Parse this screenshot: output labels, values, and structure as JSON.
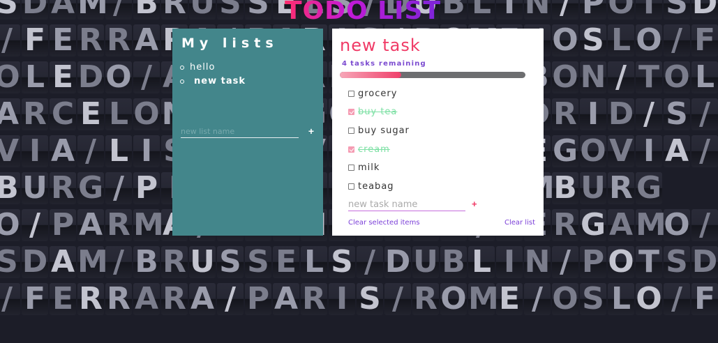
{
  "app": {
    "title": "TODO LIST"
  },
  "background": {
    "rows": [
      "SDAM/BRUSSELS/DUBLIN/POTSDAM/",
      "/FERRARA/PARIS/ROME/OSLO/FE",
      "OLEDO/AMSTERDAM/LISBON/TOLEDO",
      "ARCELONA/SEGOVIA/MADRID/S/BARCE",
      "VIA/LISBON/VIENNA/SEGOVIA/SEGOVIA",
      "BURG/PISA/MILANO/HAMBURG",
      "O/PARMA/FRANKFURT/BERGAMO/PA",
      "SDAM/BRUSSELS/DUBLIN/POTSDAM/",
      "/FERRARA/PARIS/ROME/OSLO/FE"
    ]
  },
  "lists_panel": {
    "title": "My lists",
    "items": [
      {
        "label": "hello",
        "active": false
      },
      {
        "label": "new task",
        "active": true
      }
    ],
    "new_list_placeholder": "new list name",
    "add_label": "+"
  },
  "task_panel": {
    "title": "new task",
    "remaining_count": "4",
    "remaining_text": "tasks remaining",
    "progress_fraction": 0.33,
    "tasks": [
      {
        "label": "grocery",
        "done": false
      },
      {
        "label": "buy tea",
        "done": true
      },
      {
        "label": "buy sugar",
        "done": false
      },
      {
        "label": "cream",
        "done": true
      },
      {
        "label": "milk",
        "done": false
      },
      {
        "label": "teabag",
        "done": false
      }
    ],
    "new_task_placeholder": "new task name",
    "add_label": "+",
    "clear_selected_label": "Clear selected items",
    "clear_list_label": "Clear list"
  },
  "colors": {
    "title_gradient_start": "#ff2e6e",
    "title_gradient_end": "#7b25d9",
    "lists_panel_bg": "#43868b",
    "task_title": "#f03a66",
    "accent_purple": "#7b3fd8",
    "done_text": "#7de0a4"
  }
}
